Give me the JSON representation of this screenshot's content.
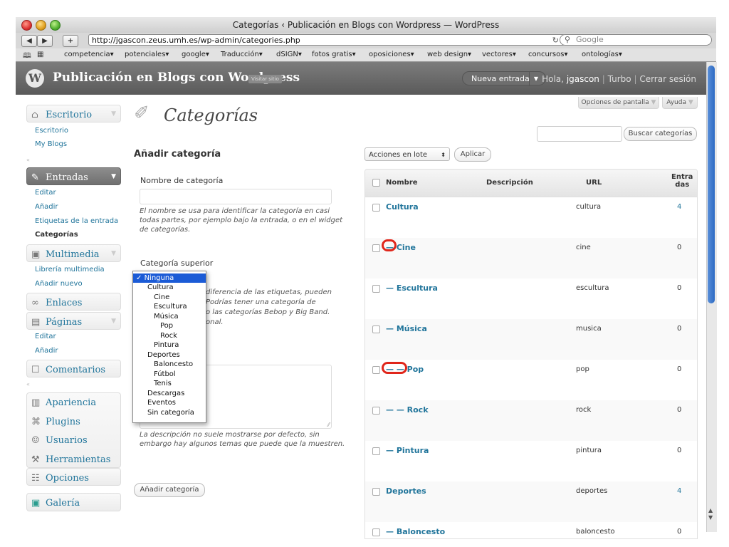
{
  "browser": {
    "window_title": "Categorías ‹ Publicación en Blogs con Wordpress — WordPress",
    "url": "http://jgascon.zeus.umh.es/wp-admin/categories.php",
    "search_placeholder": "Google",
    "bookmarks": [
      "competencia▾",
      "potenciales▾",
      "google▾",
      "Traducción▾",
      "dSIGN▾",
      "fotos gratis▾",
      "oposiciones▾",
      "web design▾",
      "vectores▾",
      "concursos▾",
      "ontologías▾"
    ]
  },
  "header": {
    "site_name": "Publicación en Blogs con Wordpress",
    "visit_site": "Visitar sitio",
    "new_post": "Nueva entrada",
    "greeting": "Hola,",
    "username": "jgascon",
    "turbo": "Turbo",
    "logout": "Cerrar sesión"
  },
  "screen_options": {
    "options": "Opciones de pantalla",
    "help": "Ayuda"
  },
  "sidebar": {
    "escritorio": {
      "label": "Escritorio",
      "subs": [
        "Escritorio",
        "My Blogs"
      ]
    },
    "entradas": {
      "label": "Entradas",
      "subs": [
        "Editar",
        "Añadir",
        "Etiquetas de la entrada",
        "Categorías"
      ]
    },
    "multimedia": {
      "label": "Multimedia",
      "subs": [
        "Librería multimedia",
        "Añadir nuevo"
      ]
    },
    "enlaces": {
      "label": "Enlaces"
    },
    "paginas": {
      "label": "Páginas",
      "subs": [
        "Editar",
        "Añadir"
      ]
    },
    "comentarios": {
      "label": "Comentarios"
    },
    "apariencia": {
      "label": "Apariencia"
    },
    "plugins": {
      "label": "Plugins"
    },
    "usuarios": {
      "label": "Usuarios"
    },
    "herramientas": {
      "label": "Herramientas"
    },
    "opciones": {
      "label": "Opciones"
    },
    "galeria": {
      "label": "Galería"
    }
  },
  "page": {
    "title": "Categorías",
    "search_button": "Buscar categorías"
  },
  "form": {
    "heading": "Añadir categoría",
    "name_label": "Nombre de categoría",
    "name_hint": "El nombre se usa para identificar la categoría en casi todas partes, por ejemplo bajo la entrada, o en el widget de categorías.",
    "parent_label": "Categoría superior",
    "parent_hint_lines": [
      "diferencia de las etiquetas, pueden",
      "Podrías tener una categoría de",
      "o las categorías Bebop y Big Band.",
      "onal."
    ],
    "description_hint": "La descripción no suele mostrarse por defecto, sin embargo hay algunos temas que puede que la muestren.",
    "submit": "Añadir categoría"
  },
  "dropdown": {
    "options": [
      {
        "label": "Ninguna",
        "indent": 0,
        "selected": true
      },
      {
        "label": "Cultura",
        "indent": 1
      },
      {
        "label": "Cine",
        "indent": 2
      },
      {
        "label": "Escultura",
        "indent": 2
      },
      {
        "label": "Música",
        "indent": 2
      },
      {
        "label": "Pop",
        "indent": 3
      },
      {
        "label": "Rock",
        "indent": 3
      },
      {
        "label": "Pintura",
        "indent": 2
      },
      {
        "label": "Deportes",
        "indent": 1
      },
      {
        "label": "Baloncesto",
        "indent": 2
      },
      {
        "label": "Fútbol",
        "indent": 2
      },
      {
        "label": "Tenis",
        "indent": 2
      },
      {
        "label": "Descargas",
        "indent": 1
      },
      {
        "label": "Eventos",
        "indent": 1
      },
      {
        "label": "Sin categoría",
        "indent": 1
      }
    ]
  },
  "table": {
    "bulk_actions": "Acciones en lote",
    "apply": "Aplicar",
    "columns": {
      "name": "Nombre",
      "description": "Descripción",
      "url": "URL",
      "count_line1": "Entra",
      "count_line2": "das"
    },
    "rows": [
      {
        "name": "Cultura",
        "slug": "cultura",
        "count": "4"
      },
      {
        "name": "— Cine",
        "slug": "cine",
        "count": "0"
      },
      {
        "name": "— Escultura",
        "slug": "escultura",
        "count": "0"
      },
      {
        "name": "— Música",
        "slug": "musica",
        "count": "0"
      },
      {
        "name": "— — Pop",
        "slug": "pop",
        "count": "0"
      },
      {
        "name": "— — Rock",
        "slug": "rock",
        "count": "0"
      },
      {
        "name": "— Pintura",
        "slug": "pintura",
        "count": "0"
      },
      {
        "name": "Deportes",
        "slug": "deportes",
        "count": "4"
      },
      {
        "name": "— Baloncesto",
        "slug": "baloncesto",
        "count": "0"
      }
    ]
  },
  "colors": {
    "link": "#21759b",
    "highlight_mark": "#e0261b",
    "header_bg": "#636363"
  }
}
